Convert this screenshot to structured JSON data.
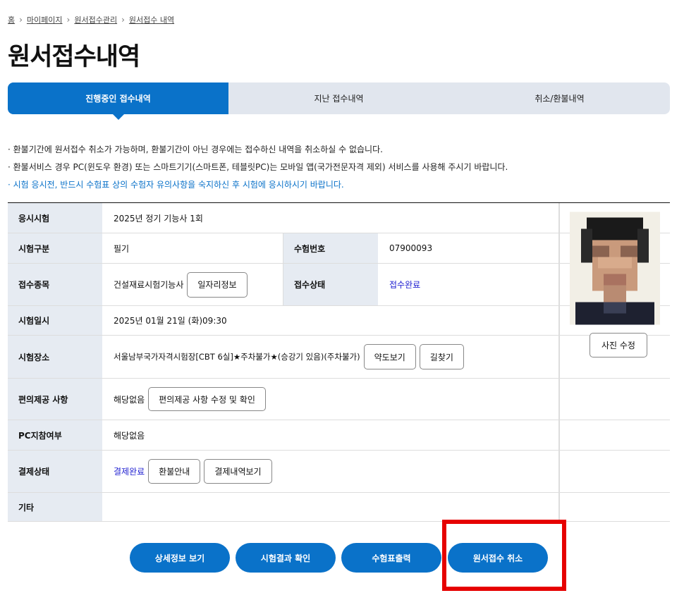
{
  "breadcrumb": [
    "홈",
    "마이페이지",
    "원서접수관리",
    "원서접수 내역"
  ],
  "page_title": "원서접수내역",
  "tabs": [
    "진행중인 접수내역",
    "지난 접수내역",
    "취소/환불내역"
  ],
  "notices": [
    "· 환불기간에 원서접수 취소가 가능하며, 환불기간이 아닌 경우에는 접수하신 내역을 취소하실 수 없습니다.",
    "· 환불서비스 경우 PC(윈도우 환경) 또는 스마트기기(스마트폰, 테블릿PC)는 모바일 앱(국가전문자격 제외) 서비스를 사용해 주시기 바랍니다.",
    "· 시험 응시전, 반드시 수험표 상의 수험자 유의사항을 숙지하신 후 시험에 응시하시기 바랍니다."
  ],
  "table": {
    "exam_label": "응시시험",
    "exam_value": "2025년 정기 기능사 1회",
    "type_label": "시험구분",
    "type_value": "필기",
    "number_label": "수험번호",
    "number_value": "07900093",
    "item_label": "접수종목",
    "item_value": "건설재료시험기능사",
    "job_info_btn": "일자리정보",
    "status_label": "접수상태",
    "status_value": "접수완료",
    "date_label": "시험일시",
    "date_value": "2025년 01월 21일 (화)09:30",
    "place_label": "시험장소",
    "place_value": "서울남부국가자격시험장[CBT 6실]★주차불가★(승강기 있음)(주차불가)",
    "map_btn": "약도보기",
    "route_btn": "길찾기",
    "conv_label": "편의제공 사항",
    "conv_value": "해당없음",
    "conv_btn": "편의제공 사항 수정 및 확인",
    "pc_label": "PC지참여부",
    "pc_value": "해당없음",
    "pay_label": "결제상태",
    "pay_value": "결제완료",
    "refund_btn": "환불안내",
    "pay_history_btn": "결제내역보기",
    "etc_label": "기타",
    "etc_value": ""
  },
  "photo_edit_btn": "사진 수정",
  "bottom_buttons": [
    "상세정보 보기",
    "시험결과 확인",
    "수험표출력",
    "원서접수 취소"
  ],
  "colors": {
    "primary": "#0a72c9",
    "highlight": "#e60000",
    "link": "#1e1ed0"
  }
}
